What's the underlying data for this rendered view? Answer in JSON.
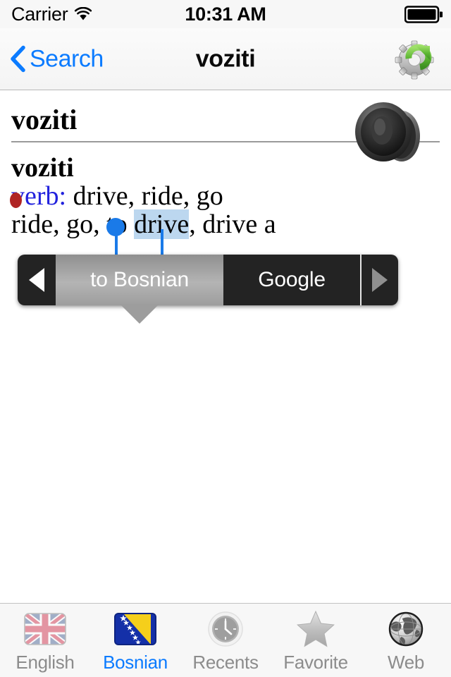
{
  "status_bar": {
    "carrier": "Carrier",
    "wifi_icon": "wifi-icon",
    "time": "10:31 AM",
    "battery_icon": "battery-full-icon"
  },
  "nav_bar": {
    "back_label": "Search",
    "back_icon": "chevron-left-icon",
    "title": "voziti",
    "action_icon": "gear-refresh-icon"
  },
  "content": {
    "headword": "voziti",
    "entry_word": "voziti",
    "part_of_speech": "verb:",
    "definition_line_1": "drive, ride, go",
    "definition_line_2_before": "ride, go, to ",
    "definition_line_2_selected": "drive",
    "definition_line_2_after": ", drive a",
    "speaker_icon": "speaker-icon",
    "selection_text": "drive",
    "selection_handle_icon": "selection-handle-icon"
  },
  "popup_menu": {
    "prev_icon": "arrow-left-icon",
    "items": [
      {
        "label": "to Bosnian",
        "state": "pressed"
      },
      {
        "label": "Google",
        "state": "normal"
      }
    ],
    "next_icon": "arrow-right-icon"
  },
  "tab_bar": {
    "tabs": [
      {
        "label": "English",
        "icon": "uk-flag-icon",
        "active": false
      },
      {
        "label": "Bosnian",
        "icon": "bosnia-flag-icon",
        "active": true
      },
      {
        "label": "Recents",
        "icon": "clock-icon",
        "active": false
      },
      {
        "label": "Favorite",
        "icon": "star-icon",
        "active": false
      },
      {
        "label": "Web",
        "icon": "globe-icon",
        "active": false
      }
    ]
  },
  "colors": {
    "accent": "#0b7bff",
    "pos_color": "#2222dd",
    "selection_highlight": "#bcd7ef",
    "popup_background": "#232323"
  }
}
